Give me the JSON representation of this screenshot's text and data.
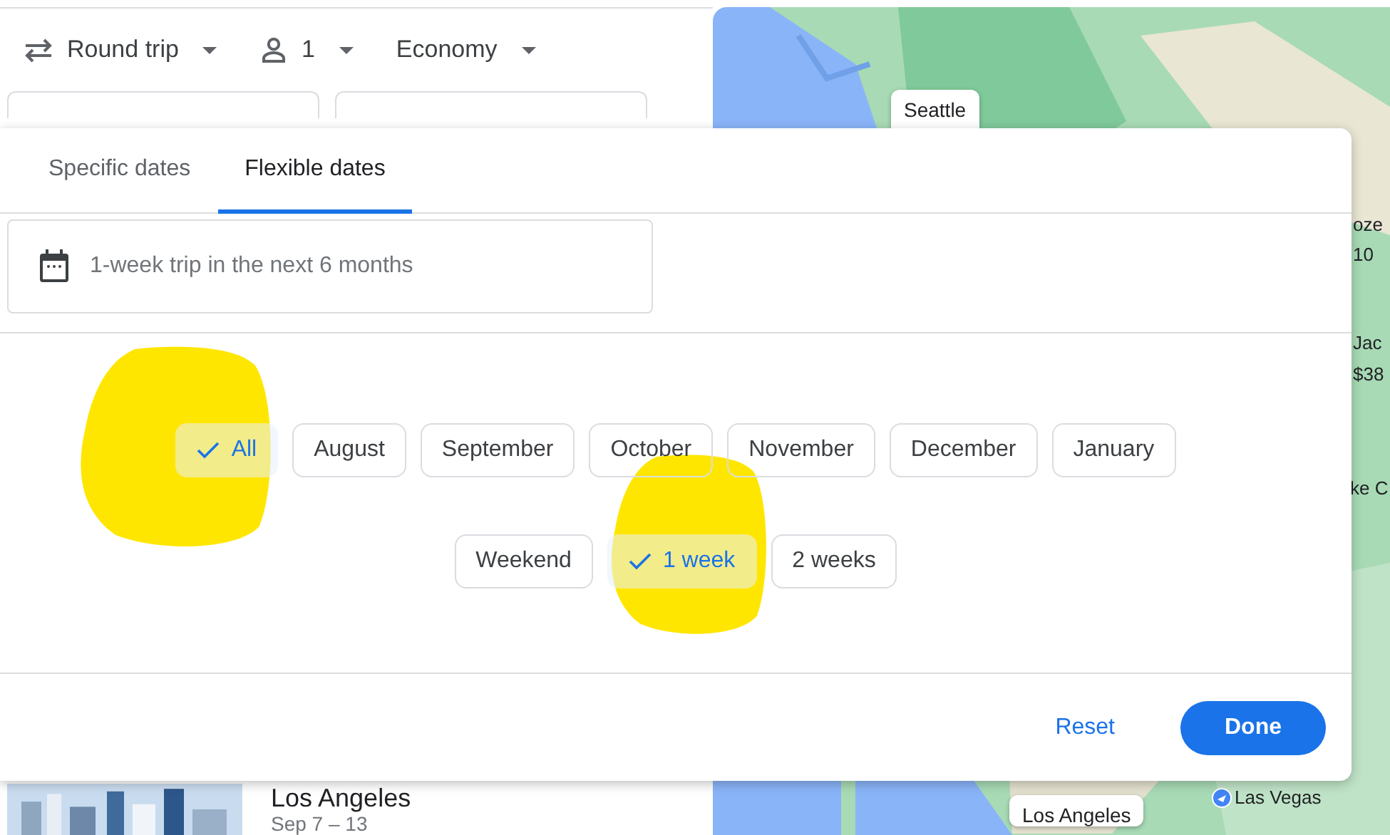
{
  "search_bar": {
    "trip_type": "Round trip",
    "passengers": "1",
    "cabin": "Economy"
  },
  "date_dialog": {
    "tabs": [
      {
        "label": "Specific dates",
        "selected": false
      },
      {
        "label": "Flexible dates",
        "selected": true
      }
    ],
    "trip_field": {
      "value": "1-week trip in the next 6 months"
    },
    "months": [
      {
        "label": "All",
        "selected": true
      },
      {
        "label": "August",
        "selected": false
      },
      {
        "label": "September",
        "selected": false
      },
      {
        "label": "October",
        "selected": false
      },
      {
        "label": "November",
        "selected": false
      },
      {
        "label": "December",
        "selected": false
      },
      {
        "label": "January",
        "selected": false
      }
    ],
    "durations": [
      {
        "label": "Weekend",
        "selected": false
      },
      {
        "label": "1 week",
        "selected": true
      },
      {
        "label": "2 weeks",
        "selected": false
      }
    ],
    "buttons": {
      "reset": "Reset",
      "done": "Done"
    }
  },
  "destination_card": {
    "city": "Los Angeles",
    "dates": "Sep 7 – 13"
  },
  "map": {
    "labels": [
      {
        "kind": "box",
        "city": "Seattle"
      },
      {
        "kind": "edge",
        "text": "oze"
      },
      {
        "kind": "edge",
        "text": "10"
      },
      {
        "kind": "edge",
        "text": "Jac"
      },
      {
        "kind": "edge",
        "text": "$38"
      },
      {
        "kind": "edge",
        "text": "ke C"
      },
      {
        "kind": "pin",
        "text": "Las Vegas"
      },
      {
        "kind": "box",
        "city": "Los Angeles"
      }
    ]
  }
}
